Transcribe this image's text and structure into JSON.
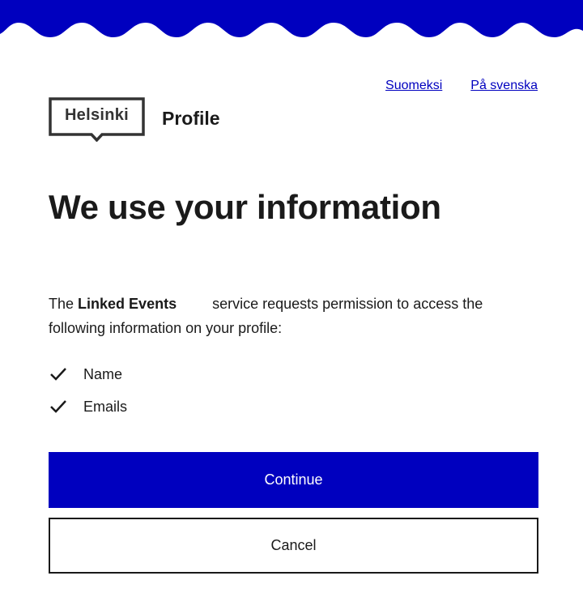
{
  "colors": {
    "brand_blue": "#0000bf",
    "text": "#1a1a1a",
    "logo": "#333333",
    "background": "#ffffff"
  },
  "header": {
    "languages": [
      "Suomeksi",
      "På svenska"
    ],
    "logo_text": "Helsinki",
    "app_name": "Profile"
  },
  "main": {
    "title": "We use your information",
    "intro_prefix": "The",
    "service_name": "Linked Events",
    "intro_suffix": "service requests permission to access the following information on your profile:",
    "permissions": [
      "Name",
      "Emails"
    ],
    "continue_label": "Continue",
    "cancel_label": "Cancel"
  },
  "icons": {
    "permission_item": "check-icon"
  }
}
